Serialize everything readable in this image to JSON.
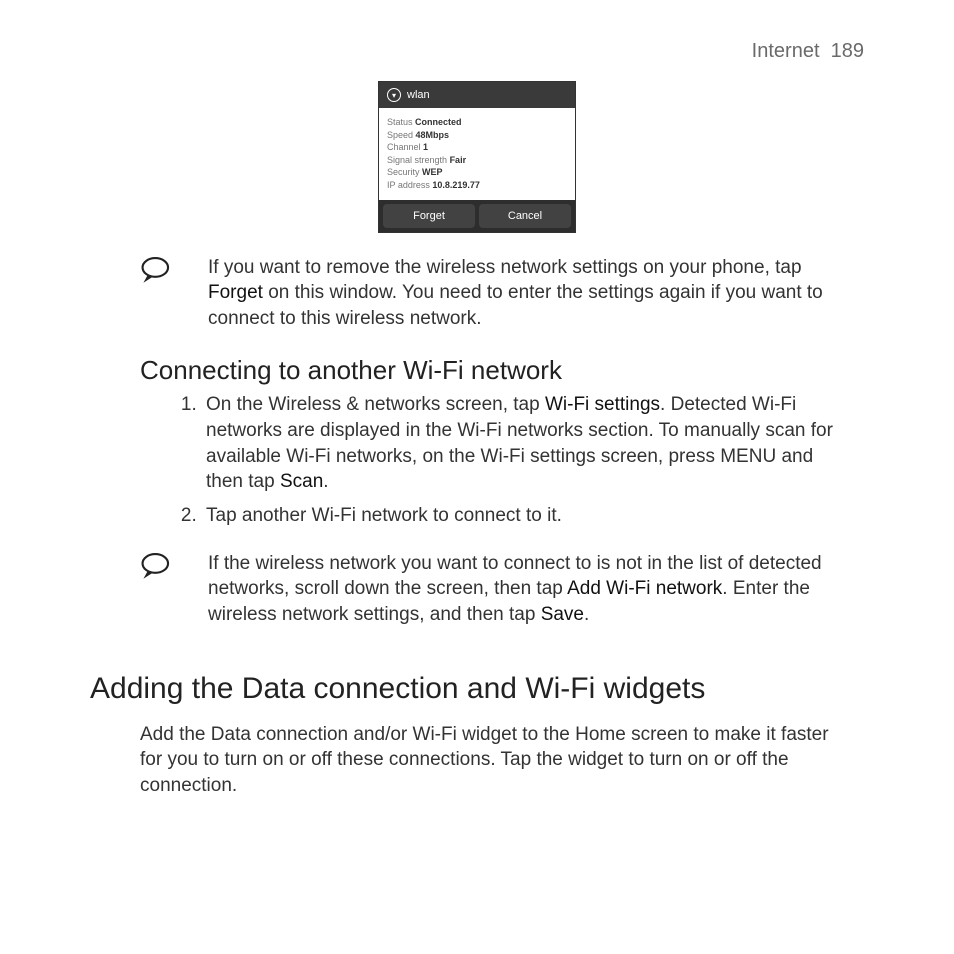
{
  "header": {
    "section": "Internet",
    "page": "189"
  },
  "wlan_dialog": {
    "title": "wlan",
    "rows": [
      {
        "label": "Status",
        "value": "Connected"
      },
      {
        "label": "Speed",
        "value": "48Mbps"
      },
      {
        "label": "Channel",
        "value": "1"
      },
      {
        "label": "Signal strength",
        "value": "Fair"
      },
      {
        "label": "Security",
        "value": "WEP"
      },
      {
        "label": "IP address",
        "value": "10.8.219.77"
      }
    ],
    "forget_btn": "Forget",
    "cancel_btn": "Cancel"
  },
  "note1": {
    "pre": "If you want to remove the wireless network settings on your phone, tap ",
    "strong": "Forget",
    "post": " on this window. You need to enter the settings again if you want to connect to this wireless network."
  },
  "section2": {
    "title": "Connecting to another Wi-Fi network",
    "step1": {
      "pre": "On the Wireless & networks screen, tap ",
      "strong1": "Wi-Fi settings",
      "mid": ". Detected Wi-Fi networks are displayed in the Wi-Fi networks section. To manually scan for available Wi-Fi networks, on the Wi-Fi settings screen, press MENU and then tap ",
      "strong2": "Scan",
      "post": "."
    },
    "step2": "Tap another Wi-Fi network to connect to it."
  },
  "note2": {
    "pre": "If the wireless network you want to connect to is not in the list of detected networks, scroll down the screen, then tap ",
    "strong1": "Add Wi-Fi network",
    "mid": ". Enter the wireless network settings, and then tap ",
    "strong2": "Save",
    "post": "."
  },
  "section3": {
    "title": "Adding the Data connection and Wi-Fi widgets",
    "body": "Add the Data connection and/or Wi-Fi widget to the Home screen to make it faster for you to turn on or off these connections. Tap the widget to turn on or off the connection."
  }
}
